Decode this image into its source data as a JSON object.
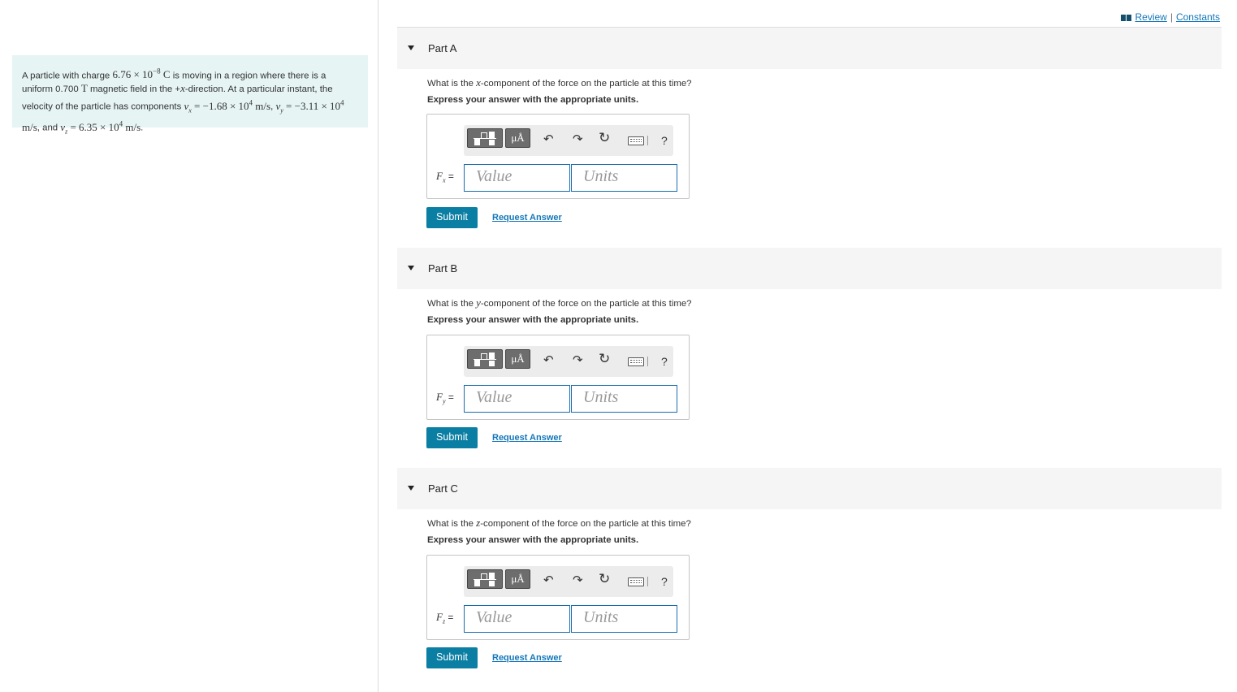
{
  "top_links": {
    "review": "Review",
    "separator": "|",
    "constants": "Constants"
  },
  "problem": {
    "t1": "A particle with charge ",
    "charge": "6.76 × 10",
    "charge_exp": "−8",
    "charge_unit": " C",
    "t2": " is moving in a region where there is a uniform 0.700 ",
    "field_unit": "T",
    "t3": " magnetic field in the +",
    "dir_var": "x",
    "t4": "-direction. At a particular instant, the velocity of the particle has components ",
    "vx_var": "v",
    "vx_sub": "x",
    "vx_val": " = −1.68 × 10",
    "vx_exp": "4",
    "vx_unit": " m/s",
    "t5": ", ",
    "vy_var": "v",
    "vy_sub": "y",
    "vy_val": " = −3.11 × 10",
    "vy_exp": "4",
    "vy_unit": " m/s",
    "t6": ", and ",
    "vz_var": "v",
    "vz_sub": "z",
    "vz_val": " = 6.35 × 10",
    "vz_exp": "4",
    "vz_unit": " m/s",
    "t7": "."
  },
  "toolbar": {
    "units_symbol": "μÅ",
    "undo": "↶",
    "redo": "↷",
    "reset": "↻",
    "help": "?"
  },
  "parts": [
    {
      "title": "Part A",
      "q_pre": "What is the ",
      "q_var": "x",
      "q_post": "-component of the force on the particle at this time?",
      "instr": "Express your answer with the appropriate units.",
      "var": "F",
      "var_sub": "x",
      "eq": " =",
      "value_ph": "Value",
      "units_ph": "Units",
      "submit": "Submit",
      "request": "Request Answer"
    },
    {
      "title": "Part B",
      "q_pre": "What is the ",
      "q_var": "y",
      "q_post": "-component of the force on the particle at this time?",
      "instr": "Express your answer with the appropriate units.",
      "var": "F",
      "var_sub": "y",
      "eq": " =",
      "value_ph": "Value",
      "units_ph": "Units",
      "submit": "Submit",
      "request": "Request Answer"
    },
    {
      "title": "Part C",
      "q_pre": "What is the ",
      "q_var": "z",
      "q_post": "-component of the force on the particle at this time?",
      "instr": "Express your answer with the appropriate units.",
      "var": "F",
      "var_sub": "z",
      "eq": " =",
      "value_ph": "Value",
      "units_ph": "Units",
      "submit": "Submit",
      "request": "Request Answer"
    }
  ]
}
